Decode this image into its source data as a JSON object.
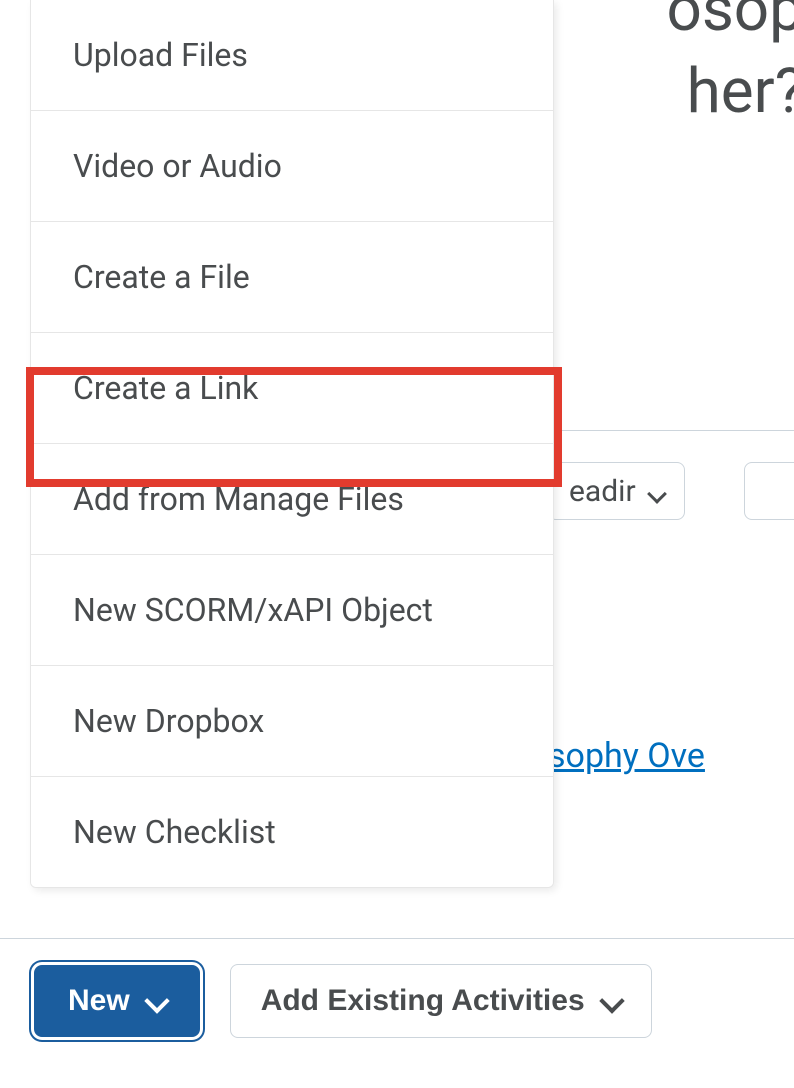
{
  "background": {
    "title_partial_1": "osop",
    "title_partial_2": "her?",
    "pill_label": "eadir",
    "link_partial": "sophy Ove"
  },
  "dropdown": {
    "items": [
      {
        "label": "Upload Files"
      },
      {
        "label": "Video or Audio"
      },
      {
        "label": "Create a File"
      },
      {
        "label": "Create a Link"
      },
      {
        "label": "Add from Manage Files"
      },
      {
        "label": "New SCORM/xAPI Object"
      },
      {
        "label": "New Dropbox"
      },
      {
        "label": "New Checklist"
      }
    ]
  },
  "buttons": {
    "new_label": "New",
    "add_existing_label": "Add Existing Activities"
  }
}
